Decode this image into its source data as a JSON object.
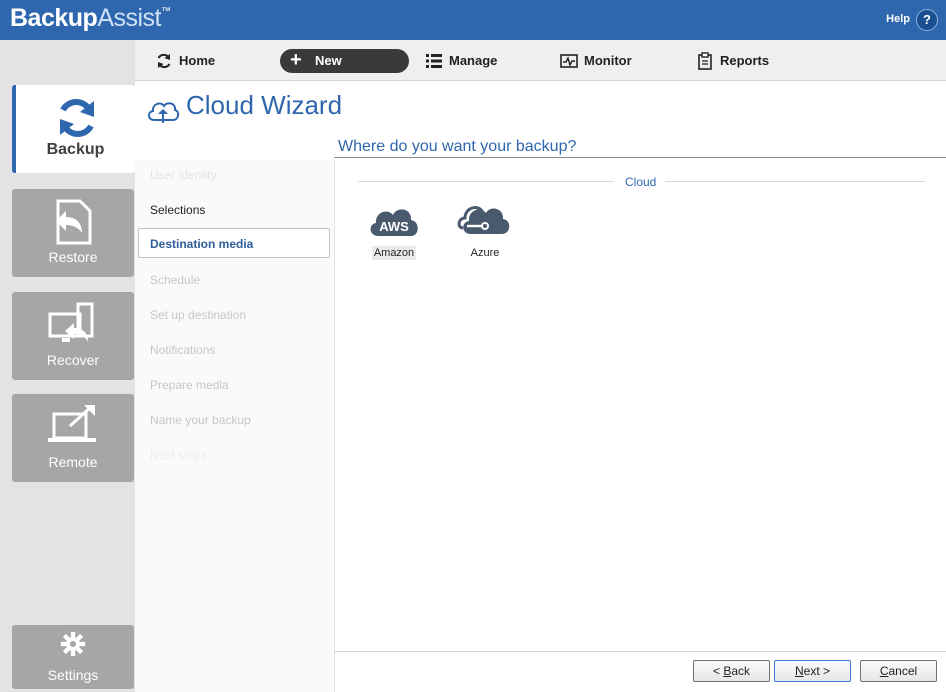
{
  "header": {
    "brand_bold": "Backup",
    "brand_light": "Assist",
    "brand_tm": "™",
    "help_label": "Help",
    "help_icon": "?"
  },
  "topnav": {
    "home": "Home",
    "new": "New",
    "manage": "Manage",
    "monitor": "Monitor",
    "reports": "Reports"
  },
  "sidebar": {
    "backup": "Backup",
    "restore": "Restore",
    "recover": "Recover",
    "remote": "Remote",
    "settings": "Settings"
  },
  "wizard": {
    "title": "Cloud Wizard",
    "steps": [
      {
        "label": "User identity",
        "state": "future"
      },
      {
        "label": "Selections",
        "state": "done"
      },
      {
        "label": "Destination media",
        "state": "active"
      },
      {
        "label": "Schedule",
        "state": "future"
      },
      {
        "label": "Set up destination",
        "state": "future"
      },
      {
        "label": "Notifications",
        "state": "future"
      },
      {
        "label": "Prepare media",
        "state": "future"
      },
      {
        "label": "Name your backup",
        "state": "future"
      },
      {
        "label": "Next steps",
        "state": "future"
      }
    ]
  },
  "main": {
    "question": "Where do you want your backup?",
    "section": "Cloud",
    "options": [
      {
        "label": "Amazon",
        "icon": "aws-cloud-icon",
        "selected": true
      },
      {
        "label": "Azure",
        "icon": "azure-cloud-icon",
        "selected": false
      }
    ],
    "aws_badge": "AWS"
  },
  "footer": {
    "back_prefix": "< ",
    "back_key": "B",
    "back_rest": "ack",
    "next_key": "N",
    "next_rest": "ext >",
    "cancel_key": "C",
    "cancel_rest": "ancel"
  },
  "colors": {
    "accent": "#2f67ae",
    "sidebar_bg": "#e3e3e3",
    "sidebar_button": "#a6a6a6"
  }
}
